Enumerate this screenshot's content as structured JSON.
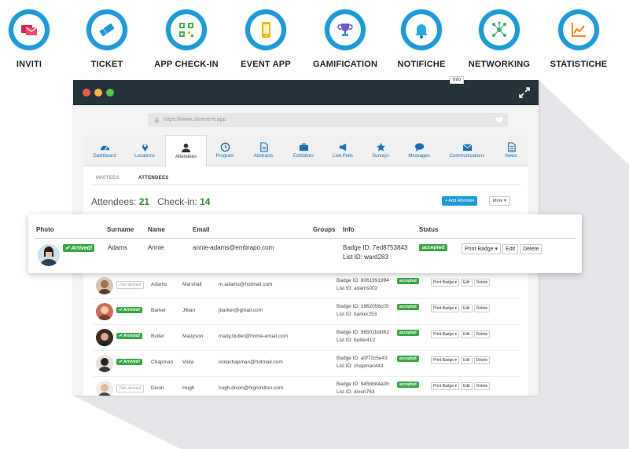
{
  "features": [
    {
      "label": "INVITI",
      "icon": "invitation-icon",
      "color": "#d6264b"
    },
    {
      "label": "TICKET",
      "icon": "ticket-icon",
      "color": "#1e9ad6"
    },
    {
      "label": "APP CHECK-IN",
      "icon": "qr-code-icon",
      "color": "#4caf50"
    },
    {
      "label": "EVENT APP",
      "icon": "smartphone-icon",
      "color": "#f5b400"
    },
    {
      "label": "GAMIFICATION",
      "icon": "trophy-icon",
      "color": "#6a5acd"
    },
    {
      "label": "NOTIFICHE",
      "icon": "bell-icon",
      "color": "#29a9e0"
    },
    {
      "label": "NETWORKING",
      "icon": "network-icon",
      "color": "#3bb273"
    },
    {
      "label": "STATISTICHE",
      "icon": "chart-icon",
      "color": "#f08a24"
    }
  ],
  "browser": {
    "url": "https://www.sitoevent.app"
  },
  "tabs": [
    {
      "label": "Dashboard",
      "icon": "dashboard-icon"
    },
    {
      "label": "Locations",
      "icon": "location-pin-icon"
    },
    {
      "label": "Attendees",
      "icon": "user-icon"
    },
    {
      "label": "Program",
      "icon": "clock-icon"
    },
    {
      "label": "Abstracts",
      "icon": "document-icon"
    },
    {
      "label": "Exhibitors",
      "icon": "briefcase-icon"
    },
    {
      "label": "Live Polls",
      "icon": "megaphone-icon"
    },
    {
      "label": "Surveys",
      "icon": "star-icon"
    },
    {
      "label": "Messages",
      "icon": "chat-icon"
    },
    {
      "label": "Communications",
      "icon": "envelope-icon"
    },
    {
      "label": "News",
      "icon": "news-icon"
    }
  ],
  "tooltip": "Info",
  "subtabs": {
    "invitees": "INVITEES",
    "attendees": "ATTENDEES"
  },
  "counts": {
    "attendees_label": "Attendees:",
    "attendees_value": "21",
    "checkin_label": "Check-in:",
    "checkin_value": "14"
  },
  "buttons": {
    "add_attendee": "+ Add Attendee",
    "more": "More ▾"
  },
  "headers": {
    "photo": "Photo",
    "surname": "Surname",
    "name": "Name",
    "email": "Email",
    "groups": "Groups",
    "info": "Info",
    "status": "Status"
  },
  "action_labels": {
    "print_badge": "Print Badge ▾",
    "edit": "Edit",
    "delete": "Delete"
  },
  "highlighted": {
    "checkin": "✔ Arrived!",
    "surname": "Adams",
    "name": "Annie",
    "email": "annie-adams@embrapo.com",
    "badge_id": "Badge ID: 7ed8753843",
    "list_id": "List ID: ward283",
    "status": "accepted"
  },
  "rows": [
    {
      "checkin": "Not arrived",
      "arrived": false,
      "surname": "Adams",
      "name": "Marshall",
      "email": "m.adams@hotmail.com",
      "badge_id": "Badge ID: 8061991994",
      "list_id": "List ID: adams002",
      "status": "accepted"
    },
    {
      "checkin": "✔ Arrived!",
      "arrived": true,
      "surname": "Barker",
      "name": "Jillian",
      "email": "jbarker@gmail.com",
      "badge_id": "Badge ID: 1962056c05",
      "list_id": "List ID: barker253",
      "status": "accepted"
    },
    {
      "checkin": "✔ Arrived!",
      "arrived": true,
      "surname": "Butler",
      "name": "Madyson",
      "email": "mady.butler@home-email.com",
      "badge_id": "Badge ID: 98501bdd62",
      "list_id": "List ID: butler412",
      "status": "accepted"
    },
    {
      "checkin": "✔ Arrived!",
      "arrived": true,
      "surname": "Chapman",
      "name": "Viola",
      "email": "violachapman@hotmail.com",
      "badge_id": "Badge ID: a0f72c5e43",
      "list_id": "List ID: chapman443",
      "status": "accepted"
    },
    {
      "checkin": "Not arrived",
      "arrived": false,
      "surname": "Dixon",
      "name": "Hugh",
      "email": "hugh.dixon@highmilton.com",
      "badge_id": "Badge ID: 945bb84a0b",
      "list_id": "List ID: dixon763",
      "status": "accepted"
    }
  ]
}
